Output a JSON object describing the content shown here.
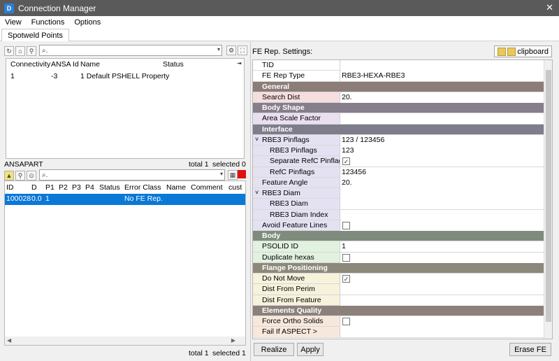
{
  "window": {
    "title": "Connection Manager",
    "close": "✕"
  },
  "menu": [
    "View",
    "Functions",
    "Options"
  ],
  "tab": "Spotweld Points",
  "upper": {
    "search_placeholder": "⌕.",
    "columns": [
      "Connectivity",
      "ANSA Id",
      "Name",
      "Status"
    ],
    "rows": [
      {
        "connectivity": "1",
        "ansa_id": "-3",
        "name": "1 Default PSHELL Property",
        "status": ""
      }
    ],
    "status_left": "ANSAPART",
    "total": "total 1",
    "selected": "selected 0"
  },
  "lower": {
    "search_placeholder": "⌕.",
    "columns": [
      "ID",
      "D",
      "P1",
      "P2",
      "P3",
      "P4",
      "Status",
      "Error Class",
      "Name",
      "Comment",
      "cust"
    ],
    "rows": [
      {
        "id": "100028",
        "d": "0.0",
        "p1": "1",
        "error_class": "No FE Rep."
      }
    ],
    "total": "total 1",
    "selected": "selected 1"
  },
  "fe": {
    "title": "FE Rep. Settings:",
    "clipboard": "clipboard",
    "rows": [
      {
        "type": "plain",
        "key": "TID",
        "value": ""
      },
      {
        "type": "plain",
        "key": "FE Rep Type",
        "value": "RBE3-HEXA-RBE3"
      },
      {
        "type": "header",
        "key": "General",
        "color": "#8c7d78"
      },
      {
        "type": "plain",
        "key": "Search Dist",
        "value": "20.",
        "bg": "#f6dede"
      },
      {
        "type": "header",
        "key": "Body Shape",
        "color": "#877e8c"
      },
      {
        "type": "plain",
        "key": "Area Scale Factor",
        "value": "",
        "bg": "#e8dff0"
      },
      {
        "type": "header",
        "key": "Interface",
        "color": "#7d7d8c"
      },
      {
        "type": "plain",
        "key": "RBE3 Pinflags",
        "value": "123 / 123456",
        "bg": "#e4e2f2",
        "arrow": "˅"
      },
      {
        "type": "plain",
        "key": "RBE3 Pinflags",
        "value": "123",
        "bg": "#e4e2f2",
        "sub": true
      },
      {
        "type": "check",
        "key": "Separate RefC Pinflags",
        "checked": true,
        "bg": "#e4e2f2",
        "sub": true
      },
      {
        "type": "plain",
        "key": "RefC Pinflags",
        "value": "123456",
        "bg": "#e4e2f2",
        "sub": true
      },
      {
        "type": "plain",
        "key": "Feature Angle",
        "value": "20.",
        "bg": "#e4e2f2"
      },
      {
        "type": "plain",
        "key": "RBE3 Diam",
        "value": "",
        "bg": "#e4e2f2",
        "arrow": "˅"
      },
      {
        "type": "plain",
        "key": "RBE3 Diam",
        "value": "",
        "bg": "#e4e2f2",
        "sub": true
      },
      {
        "type": "plain",
        "key": "RBE3 Diam Index",
        "value": "",
        "bg": "#e4e2f2",
        "sub": true
      },
      {
        "type": "check",
        "key": "Avoid Feature Lines",
        "checked": false,
        "bg": "#e4e2f2"
      },
      {
        "type": "header",
        "key": "Body",
        "color": "#7f8c7d"
      },
      {
        "type": "plain",
        "key": "PSOLID ID",
        "value": "1",
        "bg": "#e2f2e0",
        "pick": true
      },
      {
        "type": "check",
        "key": "Duplicate hexas",
        "checked": false,
        "bg": "#e2f2e0"
      },
      {
        "type": "header",
        "key": "Flange Positioning",
        "color": "#8c887a"
      },
      {
        "type": "check",
        "key": "Do Not Move",
        "checked": true,
        "bg": "#f6f2dc"
      },
      {
        "type": "plain",
        "key": "Dist From Perim",
        "value": "",
        "bg": "#f6f2dc"
      },
      {
        "type": "plain",
        "key": "Dist From Feature",
        "value": "",
        "bg": "#f6f2dc"
      },
      {
        "type": "header",
        "key": "Elements Quality",
        "color": "#8c817a"
      },
      {
        "type": "check",
        "key": "Force Ortho Solids",
        "checked": false,
        "bg": "#f8e8dc"
      },
      {
        "type": "plain",
        "key": "Fail If ASPECT >",
        "value": "",
        "bg": "#f8e8dc"
      }
    ]
  },
  "buttons": {
    "realize": "Realize",
    "apply": "Apply",
    "erase": "Erase FE"
  },
  "icons": [
    "refresh-icon",
    "home-icon",
    "zoom-icon",
    "search-icon",
    "settings-icon",
    "filter-icon",
    "clipboard-icon",
    "pick-icon"
  ]
}
